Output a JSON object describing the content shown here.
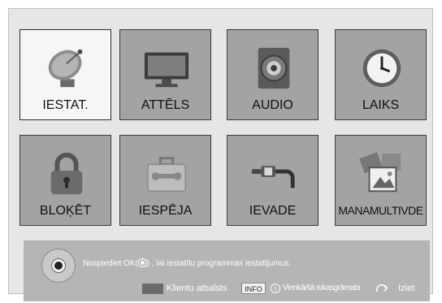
{
  "menu": {
    "items": [
      {
        "label": "IESTAT.",
        "icon": "satellite-dish-icon",
        "selected": true
      },
      {
        "label": "ATTĒLS",
        "icon": "tv-screen-icon",
        "selected": false
      },
      {
        "label": "AUDIO",
        "icon": "speaker-icon",
        "selected": false
      },
      {
        "label": "LAIKS",
        "icon": "clock-icon",
        "selected": false
      },
      {
        "label": "BLOĶĒT",
        "icon": "padlock-icon",
        "selected": false
      },
      {
        "label": "IESPĒJA",
        "icon": "toolbox-icon",
        "selected": false
      },
      {
        "label": "IEVADE",
        "icon": "cable-plug-icon",
        "selected": false
      },
      {
        "label": "MANAMULTIVDE",
        "icon": "photos-icon",
        "selected": false
      }
    ]
  },
  "footer": {
    "hint_prefix": "Nospiediet OK(",
    "hint_suffix": ") , lai iestatītu programmas iestatījumus.",
    "support_label": "Klientu atbalsts",
    "info_key": "INFO",
    "info_glyph": "i",
    "manual_label": "Vienkāršā rokasgrāmata",
    "exit_label": "Iziet"
  }
}
